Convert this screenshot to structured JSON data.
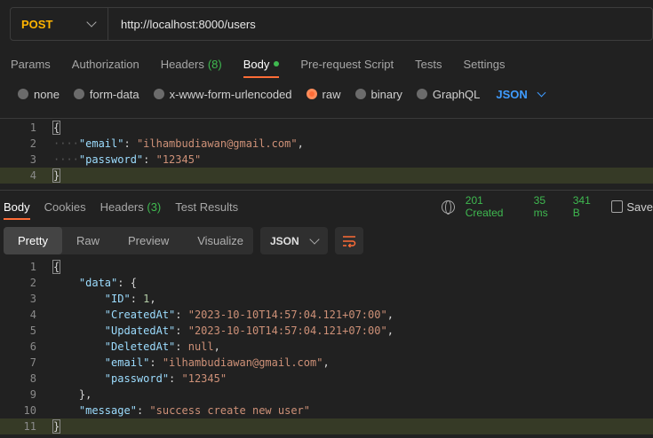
{
  "request": {
    "method": "POST",
    "url": "http://localhost:8000/users"
  },
  "req_tabs": {
    "params": "Params",
    "authorization": "Authorization",
    "headers": "Headers",
    "headers_count": "(8)",
    "body": "Body",
    "prerequest": "Pre-request Script",
    "tests": "Tests",
    "settings": "Settings"
  },
  "body_types": {
    "none": "none",
    "form_data": "form-data",
    "urlencoded": "x-www-form-urlencoded",
    "raw": "raw",
    "binary": "binary",
    "graphql": "GraphQL",
    "format": "JSON",
    "selected": "raw"
  },
  "request_body": {
    "line_numbers": [
      "1",
      "2",
      "3",
      "4"
    ],
    "open": "{",
    "email_key": "\"email\"",
    "email_value": "\"ilhambudiawan@gmail.com\"",
    "password_key": "\"password\"",
    "password_value": "\"12345\"",
    "close": "}"
  },
  "resp_tabs": {
    "body": "Body",
    "cookies": "Cookies",
    "headers": "Headers",
    "headers_count": "(3)",
    "test_results": "Test Results"
  },
  "status": {
    "code": "201 Created",
    "time": "35 ms",
    "size": "341 B",
    "save": "Save"
  },
  "view_modes": {
    "pretty": "Pretty",
    "raw": "Raw",
    "preview": "Preview",
    "visualize": "Visualize",
    "format": "JSON"
  },
  "response_body": {
    "line_numbers": [
      "1",
      "2",
      "3",
      "4",
      "5",
      "6",
      "7",
      "8",
      "9",
      "10",
      "11"
    ],
    "open": "{",
    "data_key": "\"data\"",
    "id_key": "\"ID\"",
    "id_value": "1",
    "created_key": "\"CreatedAt\"",
    "created_value": "\"2023-10-10T14:57:04.121+07:00\"",
    "updated_key": "\"UpdatedAt\"",
    "updated_value": "\"2023-10-10T14:57:04.121+07:00\"",
    "deleted_key": "\"DeletedAt\"",
    "deleted_value": "null",
    "email_key": "\"email\"",
    "email_value": "\"ilhambudiawan@gmail.com\"",
    "password_key": "\"password\"",
    "password_value": "\"12345\"",
    "message_key": "\"message\"",
    "message_value": "\"success create new user\"",
    "close": "}"
  },
  "colors": {
    "accent": "#ff6c37",
    "success": "#3fb950",
    "method": "#ffb400",
    "json_link": "#3f9cff"
  }
}
